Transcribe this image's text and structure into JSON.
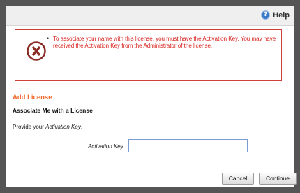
{
  "toolbar": {
    "help_label": "Help",
    "help_icon": "help-icon"
  },
  "error": {
    "icon": "error-x-icon",
    "message": "To associate your name with this license, you must have the Activation Key. You may have received the Activation Key from the Administrator of the license.",
    "color": "#d6201b"
  },
  "section": {
    "title": "Add License",
    "title_color": "#f26a2c"
  },
  "form": {
    "heading": "Associate Me with a License",
    "instruction_prefix": "Provide your ",
    "instruction_em": "Activation Key",
    "instruction_suffix": ".",
    "field_label": "Activation Key",
    "field_value": ""
  },
  "buttons": {
    "cancel_label": "Cancel",
    "continue_label": "Continue"
  }
}
